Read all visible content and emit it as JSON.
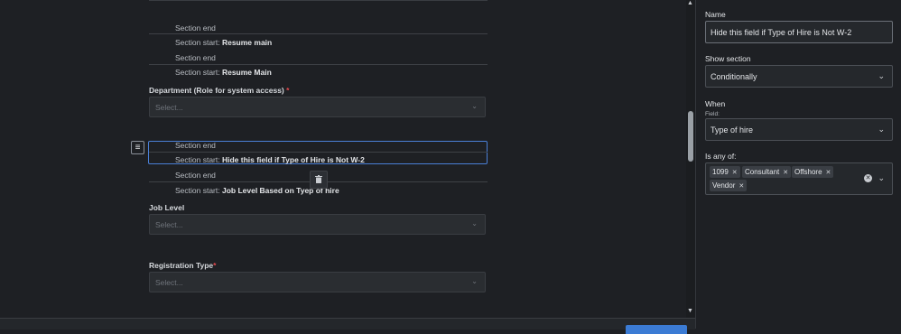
{
  "sections": [
    {
      "prefix": "Section end",
      "name": ""
    },
    {
      "prefix": "Section start: ",
      "name": "Resume main"
    },
    {
      "prefix": "Section end",
      "name": ""
    },
    {
      "prefix": "Section start: ",
      "name": "Resume Main"
    }
  ],
  "fields": {
    "department": {
      "label": "Department (Role for system access)",
      "required_mark": "*",
      "placeholder": "Select..."
    },
    "job_level": {
      "label": "Job Level",
      "placeholder": "Select..."
    },
    "registration": {
      "label": "Registration Type",
      "required_mark": "*",
      "placeholder": "Select..."
    }
  },
  "selected_block": {
    "end_label": "Section end",
    "start_prefix": "Section start: ",
    "start_name": "Hide this field if Type of Hire is Not W-2"
  },
  "after_block": {
    "end_label": "Section end",
    "start_prefix": "Section start: ",
    "start_name": "Job Level  Based on Tyep of hire"
  },
  "panel": {
    "name_label": "Name",
    "name_value": "Hide this field if Type of Hire is Not W-2",
    "show_section_label": "Show section",
    "show_section_value": "Conditionally",
    "when_label": "When",
    "field_sublabel": "Field:",
    "field_value": "Type of hire",
    "is_any_of_label": "Is any of:",
    "chips": [
      "1099",
      "Consultant",
      "Offshore",
      "Vendor"
    ]
  },
  "icons": {
    "drag": "drag-handle-icon",
    "trash": "trash-icon",
    "chevron": "chevron-down-icon",
    "clear": "clear-icon",
    "chip_remove": "close-icon"
  },
  "colors": {
    "accent": "#4a7fd6",
    "required": "#e5484d",
    "primary_button": "#3b7bd4"
  }
}
